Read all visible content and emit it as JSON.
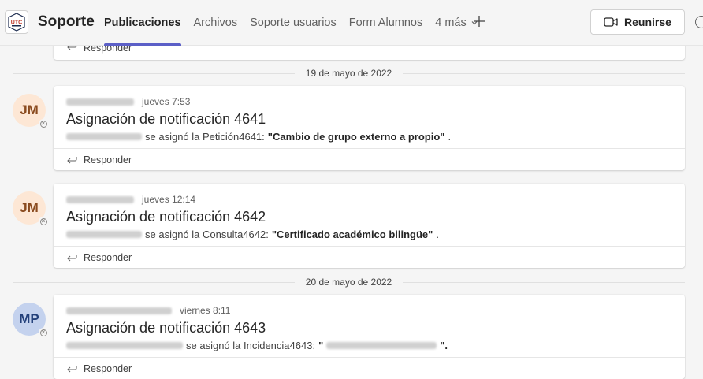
{
  "header": {
    "team_name": "Soporte",
    "logo_text": "UTC",
    "tabs": [
      {
        "label": "Publicaciones",
        "active": true
      },
      {
        "label": "Archivos"
      },
      {
        "label": "Soporte usuarios"
      },
      {
        "label": "Form Alumnos"
      },
      {
        "label": "4 más"
      }
    ],
    "meet_label": "Reunirse",
    "accent_color": "#5b5fc7"
  },
  "top_reply_label": "Responder",
  "dividers": [
    "19 de mayo de 2022",
    "20 de mayo de 2022"
  ],
  "posts": [
    {
      "avatar_initials": "JM",
      "timestamp": "jueves 7:53",
      "subject": "Asignación de notificación 4641",
      "action_text": "se asignó la Petición4641:",
      "item_title": "\"Cambio de grupo externo a propio\"",
      "reply_label": "Responder"
    },
    {
      "avatar_initials": "JM",
      "timestamp": "jueves 12:14",
      "subject": "Asignación de notificación 4642",
      "action_text": "se asignó la Consulta4642:",
      "item_title": "\"Certificado académico bilingüe\"",
      "reply_label": "Responder"
    },
    {
      "avatar_initials": "MP",
      "timestamp": "viernes 8:11",
      "subject": "Asignación de notificación 4643",
      "action_text": "se asignó la Incidencia4643:",
      "item_title_open": "\"",
      "item_title_close": "\".",
      "reply_label": "Responder"
    }
  ],
  "post_end_punct": "."
}
